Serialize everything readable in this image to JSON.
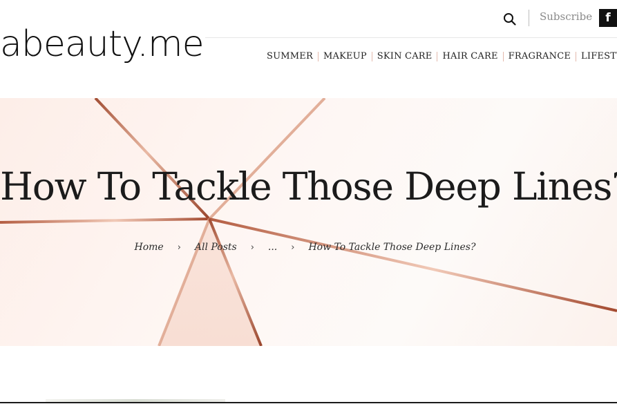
{
  "site": {
    "logo_text": "abeauty.me",
    "subscribe_label": "Subscribe",
    "facebook_glyph": "f",
    "icons": [
      "search-icon",
      "facebook-icon"
    ]
  },
  "nav": {
    "items": [
      "SUMMER",
      "MAKEUP",
      "SKIN CARE",
      "HAIR CARE",
      "FRAGRANCE",
      "LIFESTYLE"
    ]
  },
  "hero": {
    "title": "How To Tackle Those Deep Lines?",
    "breadcrumb": [
      "Home",
      "All Posts",
      "...",
      "How To Tackle Those Deep Lines?"
    ]
  },
  "colors": {
    "accent_copper": "#b5654a",
    "hero_background": "#fdf1ec",
    "text": "#1b1b1b"
  }
}
